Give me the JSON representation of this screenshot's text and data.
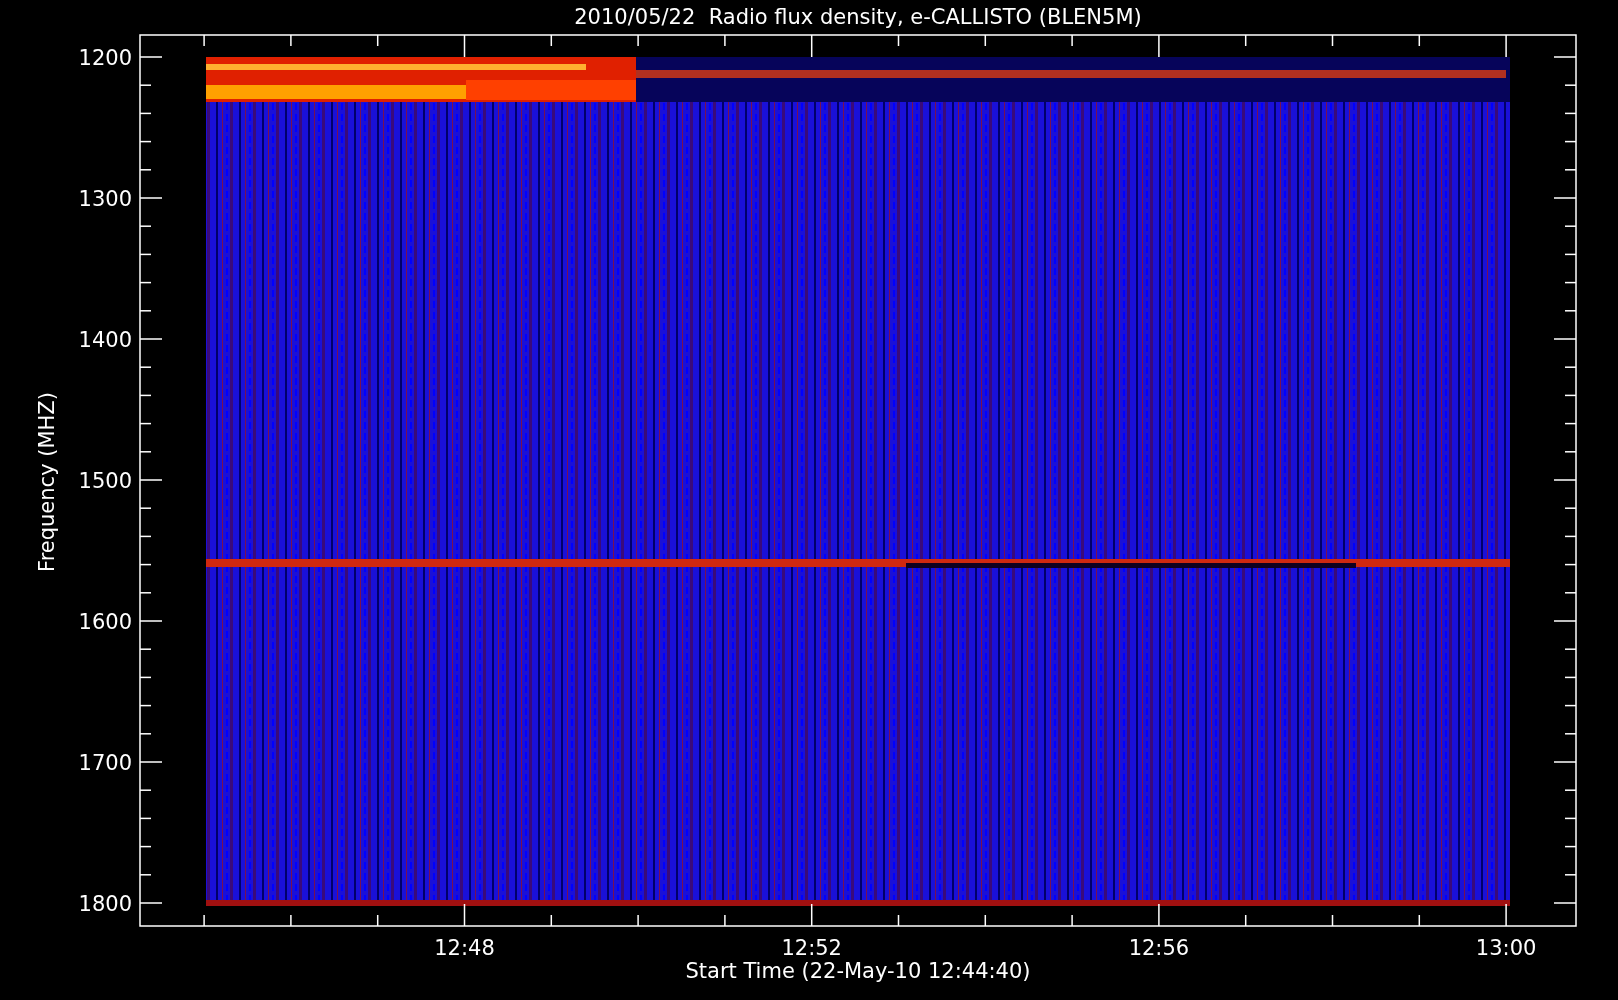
{
  "title": "2010/05/22  Radio flux density, e-CALLISTO (BLEN5M)",
  "y_axis": {
    "label": "Frequency (MHZ)",
    "ticks": [
      "1200",
      "1300",
      "1400",
      "1500",
      "1600",
      "1700",
      "1800"
    ]
  },
  "x_axis": {
    "label": "Start Time (22-May-10 12:44:40)",
    "ticks": [
      "12:48",
      "12:52",
      "12:56",
      "13:00"
    ]
  }
}
